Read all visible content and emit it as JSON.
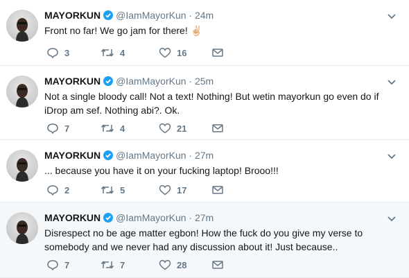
{
  "tweets": [
    {
      "name": "MAYORKUN",
      "handle": "@IamMayorKun",
      "separator": "·",
      "time": "24m",
      "text": "Front no far! We go jam for there! ✌🏻",
      "replies": "3",
      "retweets": "4",
      "likes": "16"
    },
    {
      "name": "MAYORKUN",
      "handle": "@IamMayorKun",
      "separator": "·",
      "time": "25m",
      "text": "Not a single bloody call! Not a text! Nothing! But wetin mayorkun go even do if iDrop am sef. Nothing abi?. Ok.",
      "replies": "7",
      "retweets": "4",
      "likes": "21"
    },
    {
      "name": "MAYORKUN",
      "handle": "@IamMayorKun",
      "separator": "·",
      "time": "27m",
      "text": "... because you have it on your fucking laptop! Brooo!!!",
      "replies": "2",
      "retweets": "5",
      "likes": "17"
    },
    {
      "name": "MAYORKUN",
      "handle": "@IamMayorKun",
      "separator": "·",
      "time": "27m",
      "text": "Disrespect no be age matter egbon! How the fuck do you give my verse to somebody and we never had any discussion about it! Just because..",
      "replies": "7",
      "retweets": "7",
      "likes": "28"
    }
  ],
  "icons": {
    "verified": "verified-badge-icon",
    "reply": "reply-icon",
    "retweet": "retweet-icon",
    "like": "heart-icon",
    "dm": "envelope-icon",
    "menu": "chevron-down-icon"
  },
  "colors": {
    "verified": "#1da1f2",
    "secondary_text": "#657786",
    "primary_text": "#14171a",
    "highlight_bg": "#f5f8fa"
  }
}
